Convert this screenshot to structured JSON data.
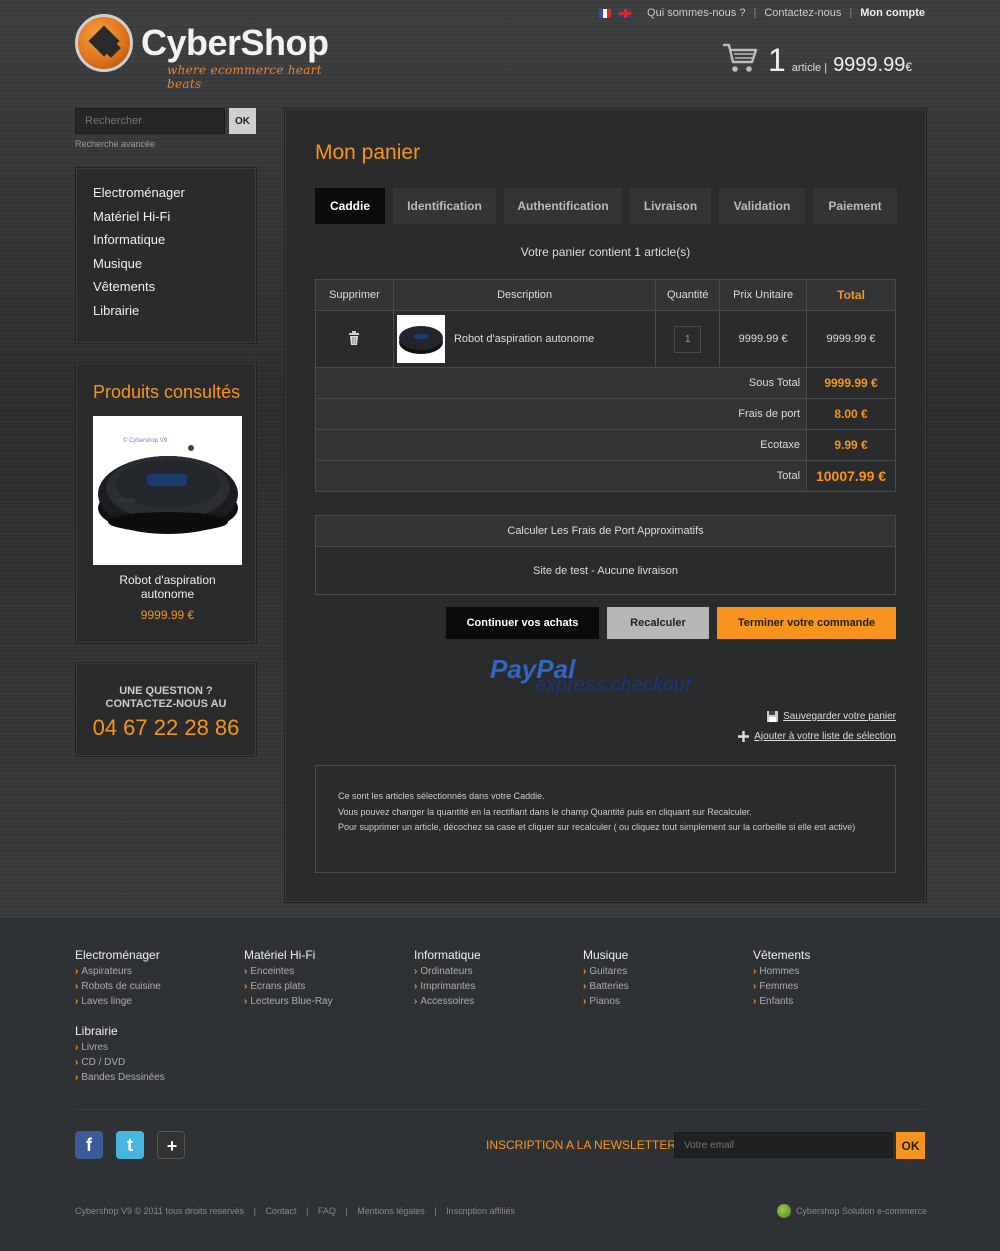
{
  "brand": {
    "name": "CyberShop",
    "tagline": "where ecommerce heart beats"
  },
  "top_links": {
    "about": "Qui sommes-nous ?",
    "contact": "Contactez-nous",
    "account": "Mon compte"
  },
  "cart_summary": {
    "count": "1",
    "label": "article |",
    "total": "9999.99",
    "currency": "€"
  },
  "search": {
    "placeholder": "Rechercher",
    "button": "OK",
    "advanced": "Recherche avancée"
  },
  "categories": [
    "Electroménager",
    "Matériel Hi-Fi",
    "Informatique",
    "Musique",
    "Vêtements",
    "Librairie"
  ],
  "viewed": {
    "title": "Produits consultés",
    "product_name": "Robot d'aspiration autonome",
    "product_price": "9999.99 €",
    "image_caption": "© Cybershop V9"
  },
  "contact_box": {
    "question_1": "UNE QUESTION ?",
    "question_2": "CONTACTEZ-NOUS AU",
    "phone": "04 67 22 28 86"
  },
  "main": {
    "title": "Mon panier",
    "steps": [
      "Caddie",
      "Identification",
      "Authentification",
      "Livraison",
      "Validation",
      "Paiement"
    ],
    "active_step": "Caddie",
    "cart_message": "Votre panier contient 1 article(s)",
    "table_headers": [
      "Supprimer",
      "Description",
      "Quantité",
      "Prix Unitaire",
      "Total"
    ],
    "items": [
      {
        "description": "Robot d'aspiration autonome",
        "quantity": "1",
        "unit_price": "9999.99 €",
        "total": "9999.99 €"
      }
    ],
    "summary": [
      {
        "label": "Sous Total",
        "value": "9999.99 €"
      },
      {
        "label": "Frais de port",
        "value": "8.00 €"
      },
      {
        "label": "Ecotaxe",
        "value": "9.99 €"
      },
      {
        "label": "Total",
        "value": "10007.99 €"
      }
    ],
    "shipping_header": "Calculer Les Frais de Port Approximatifs",
    "shipping_body": "Site de test - Aucune livraison",
    "buttons": {
      "continue": "Continuer vos achats",
      "recalc": "Recalculer",
      "finish": "Terminer votre commande"
    },
    "paypal": {
      "brand_1": "Pay",
      "brand_2": "Pal",
      "sub": "express checkout"
    },
    "save_link": "Sauvegarder votre panier",
    "wishlist_link": "Ajouter à votre liste de sélection",
    "info_lines": [
      "Ce sont les articles sélectionnés dans votre Caddie.",
      "Vous pouvez changer la quantité en la rectifiant dans le champ Quantité puis en cliquant sur Recalculer.",
      "Pour supprimer un article, décochez sa case et cliquer sur recalculer ( ou cliquez tout simplement sur la corbeille si elle est active)"
    ]
  },
  "footer": {
    "columns": [
      {
        "title": "Electroménager",
        "links": [
          "Aspirateurs",
          "Robots de cuisine",
          "Laves linge"
        ]
      },
      {
        "title": "Matériel Hi-Fi",
        "links": [
          "Enceintes",
          "Ecrans plats",
          "Lecteurs Blue-Ray"
        ]
      },
      {
        "title": "Informatique",
        "links": [
          "Ordinateurs",
          "Imprimantes",
          "Accessoires"
        ]
      },
      {
        "title": "Musique",
        "links": [
          "Guitares",
          "Batteries",
          "Pianos"
        ]
      },
      {
        "title": "Vêtements",
        "links": [
          "Hommes",
          "Femmes",
          "Enfants"
        ]
      },
      {
        "title": "Librairie",
        "links": [
          "Livres",
          "CD / DVD",
          "Bandes Dessinées"
        ]
      }
    ],
    "newsletter_label": "INSCRIPTION A LA NEWSLETTER :",
    "newsletter_placeholder": "Votre email",
    "newsletter_button": "OK",
    "copyright": "Cybershop V9 © 2011 tous droits reservés",
    "bottom_links": [
      "Contact",
      "FAQ",
      "Mentions légales",
      "Inscription affiliés"
    ],
    "solution": "Cybershop Solution e-commerce"
  },
  "colors": {
    "accent": "#f7941d",
    "background": "#2f3235",
    "panel": "#2a2b2d",
    "text": "#dddddd"
  }
}
